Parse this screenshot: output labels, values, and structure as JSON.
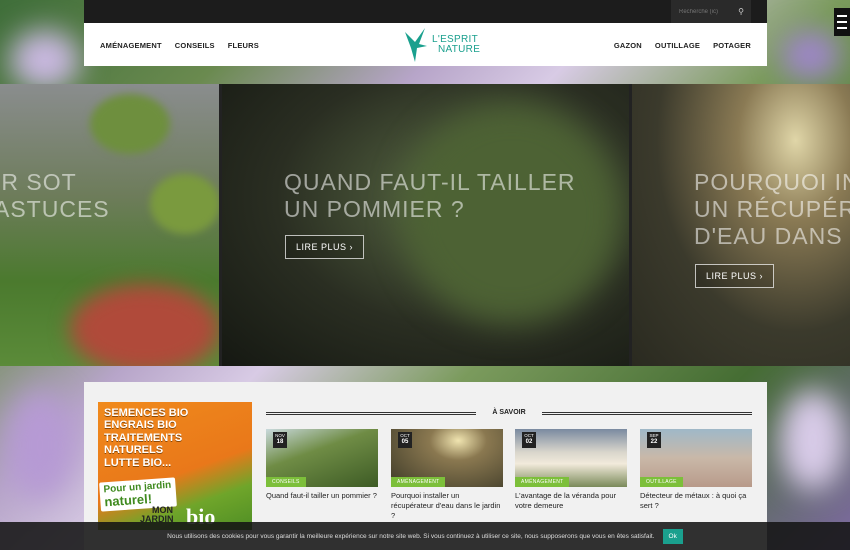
{
  "topbar": {
    "search_placeholder": "Recherche (ic)"
  },
  "nav": {
    "left": [
      "AMÉNAGEMENT",
      "CONSEILS",
      "FLEURS"
    ],
    "right": [
      "GAZON",
      "OUTILLAGE",
      "POTAGER"
    ]
  },
  "logo": {
    "line1": "L'ESPRIT",
    "line2": "NATURE"
  },
  "slides": [
    {
      "title_line1": "IR SOT",
      "title_line2": "ASTUCES",
      "title_line3": ""
    },
    {
      "title_line1": "QUAND FAUT-IL TAILLER",
      "title_line2": "UN POMMIER ?",
      "read_more": "LIRE PLUS"
    },
    {
      "title_line1": "POURQUOI IN",
      "title_line2": "UN RÉCUPÉR",
      "title_line3": "D'EAU DANS L",
      "read_more": "LIRE PLUS"
    }
  ],
  "ad": {
    "lines": [
      "SEMENCES BIO",
      "ENGRAIS BIO",
      "TRAITEMENTS",
      "NATURELS",
      "LUTTE BIO..."
    ],
    "badge_line1": "Pour un jardin",
    "badge_line2": "naturel!",
    "brand_line1": "MON",
    "brand_line2": "JARDIN",
    "brand_bio": "bio"
  },
  "section_title": "À SAVOIR",
  "cards": [
    {
      "month": "NOV",
      "day": "18",
      "category": "CONSEILS",
      "title": "Quand faut-il tailler un pommier ?"
    },
    {
      "month": "OCT",
      "day": "05",
      "category": "AMÉNAGEMENT",
      "title": "Pourquoi installer un récupérateur d'eau dans le jardin ?"
    },
    {
      "month": "OCT",
      "day": "02",
      "category": "AMÉNAGEMENT",
      "title": "L'avantage de la véranda pour votre demeure"
    },
    {
      "month": "SEP",
      "day": "22",
      "category": "OUTILLAGE",
      "title": "Détecteur de métaux : à quoi ça sert ?"
    }
  ],
  "cookie": {
    "message": "Nous utilisons des cookies pour vous garantir la meilleure expérience sur notre site web. Si vous continuez à utiliser ce site, nous supposerons que vous en êtes satisfait.",
    "ok_label": "Ok"
  },
  "colors": {
    "accent": "#1aa08e",
    "category": "#7cbf3a"
  }
}
